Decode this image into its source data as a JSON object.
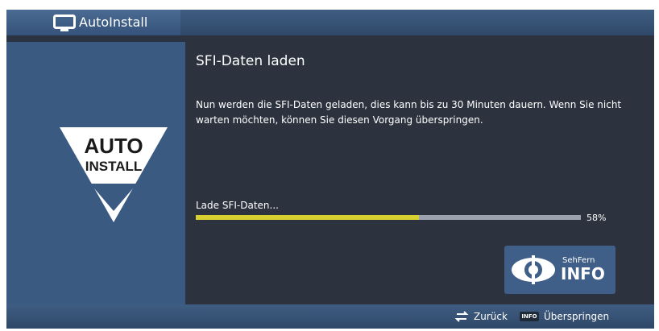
{
  "window": {
    "title": "AutoInstall",
    "icon": "tv-icon"
  },
  "sidebar": {
    "logo_line1": "AUTO",
    "logo_line2": "INSTALL"
  },
  "main": {
    "heading": "SFI-Daten laden",
    "description": "Nun werden die SFI-Daten geladen, dies kann bis zu 30 Minuten dauern. Wenn Sie nicht warten möchten, können Sie diesen Vorgang überspringen.",
    "progress": {
      "label": "Lade SFI-Daten...",
      "value": 58,
      "percent_text": "58%"
    },
    "badge": {
      "brand": "SehFern",
      "word": "INFO",
      "icon": "eye-icon"
    }
  },
  "footer": {
    "back_label": "Zurück",
    "info_key": "INFO",
    "skip_label": "Überspringen"
  },
  "colors": {
    "accent_blue": "#3b5a82",
    "background": "#2c333f",
    "progress_fill": "#d8d030",
    "progress_track": "#9ba3ae"
  }
}
